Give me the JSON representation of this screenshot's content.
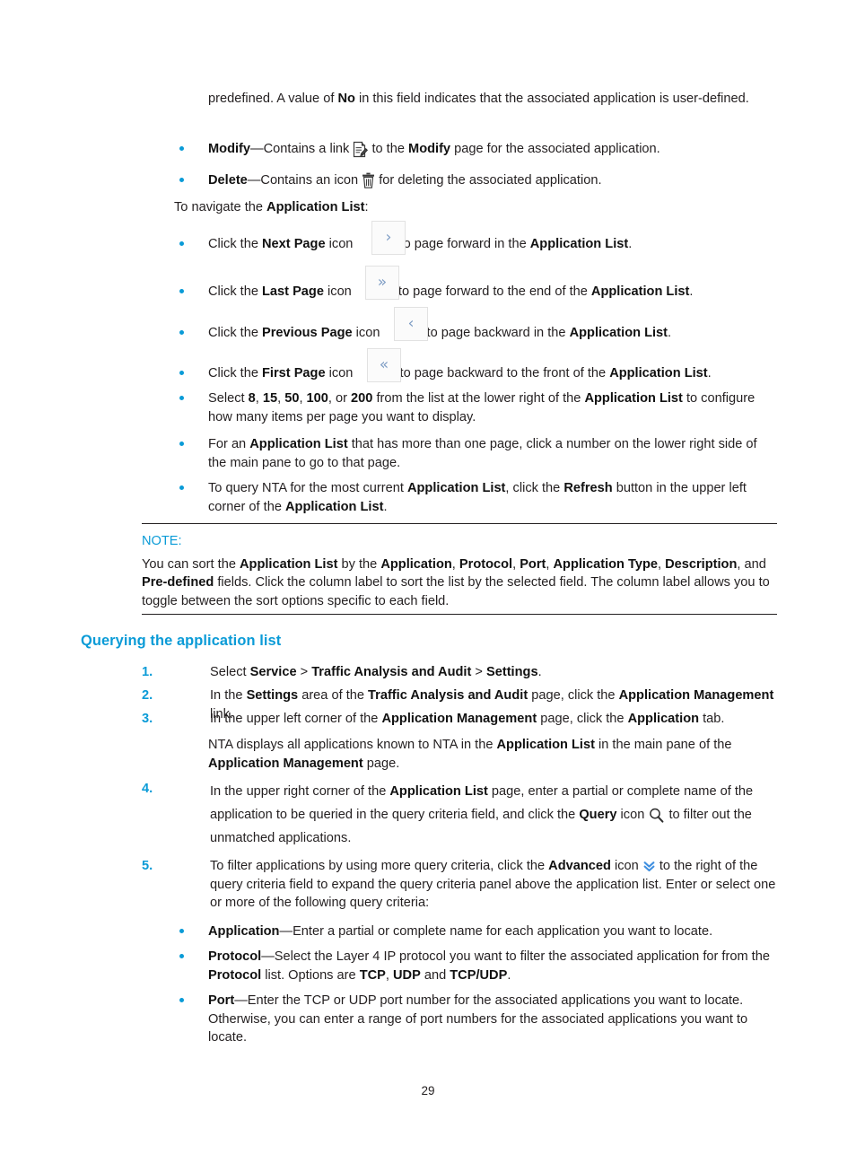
{
  "document": {
    "page_number": "29",
    "accent_color": "#0a9bd7",
    "text_color": "#231f20"
  },
  "intro": {
    "line1_a": "predefined. A value of ",
    "line1_b": "No",
    "line1_c": " in this field indicates that the associated application is user-defined."
  },
  "field_bullets": [
    {
      "term": "Modify",
      "before_icon": "—Contains a link ",
      "icon": "modify-icon",
      "after_icon_a": " to the ",
      "after_icon_b": "Modify",
      "after_icon_c": " page for the associated application."
    },
    {
      "term": "Delete",
      "before_icon": "—Contains an icon ",
      "icon": "trash-icon",
      "after_icon_a": " for deleting the associated application.",
      "after_icon_b": "",
      "after_icon_c": ""
    }
  ],
  "navigate_intro": {
    "a": "To navigate the ",
    "b": "Application List",
    "c": ":"
  },
  "navigation_bullets": [
    {
      "lead": "Click the ",
      "term": "Next Page",
      "mid": " icon ",
      "icon": "chevron-right-icon",
      "glyph": "›",
      "tail_a": " to page forward in the ",
      "tail_b": "Application List",
      "tail_c": "."
    },
    {
      "lead": "Click the ",
      "term": "Last Page",
      "mid": " icon ",
      "icon": "chevron-double-right-icon",
      "glyph": "»",
      "tail_a": " to page forward to the end of the ",
      "tail_b": "Application List",
      "tail_c": "."
    },
    {
      "lead": "Click the ",
      "term": "Previous Page",
      "mid": " icon ",
      "icon": "chevron-left-icon",
      "glyph": "‹",
      "tail_a": " to page backward in the ",
      "tail_b": "Application List",
      "tail_c": "."
    },
    {
      "lead": "Click the ",
      "term": "First Page",
      "mid": " icon ",
      "icon": "chevron-double-left-icon",
      "glyph": "«",
      "tail_a": " to page backward to the front of the ",
      "tail_b": "Application List",
      "tail_c": "."
    }
  ],
  "page_size_bullet": {
    "lead": "Select ",
    "options": [
      "8",
      "15",
      "50",
      "100",
      "200"
    ],
    "mid": " from the list at the lower right of the ",
    "term": "Application List",
    "tail": " to configure how many items per page you want to display."
  },
  "multi_page_bullet": {
    "lead": "For an ",
    "term": "Application List",
    "tail": " that has more than one page, click a number on the lower right side of the main pane to go to that page."
  },
  "refresh_bullet": {
    "lead": "To query NTA for the most current ",
    "term1": "Application List",
    "mid1": ", click the ",
    "term2": "Refresh",
    "mid2": " button in the upper left corner of the ",
    "term3": "Application List",
    "tail": "."
  },
  "note": {
    "label": "NOTE:",
    "body_a": "You can sort the ",
    "body_b": "Application List",
    "body_c": " by the ",
    "fields": [
      "Application",
      "Protocol",
      "Port",
      "Application Type",
      "Description"
    ],
    "body_d": ", and ",
    "body_e": "Pre-defined",
    "body_f": " fields. Click the column label to sort the list by the selected field. The column label allows you to toggle between the sort options specific to each field."
  },
  "section": {
    "heading": "Querying the application list"
  },
  "steps": [
    {
      "number": "1.",
      "lead": "Select ",
      "parts": [
        "Service",
        " > ",
        "Traffic Analysis and Audit",
        " > ",
        "Settings"
      ],
      "tail": "."
    },
    {
      "number": "2.",
      "lead": "In the ",
      "b1": "Settings",
      "m1": " area of the ",
      "b2": "Traffic Analysis and Audit",
      "m2": " page, click the ",
      "b3": "Application Management",
      "tail": " link."
    },
    {
      "number": "3.",
      "lead": "In the upper left corner of the ",
      "b1": "Application Management",
      "m1": " page, click the ",
      "b2": "Application",
      "tail": " tab."
    },
    {
      "number": "4.",
      "lead": "In the upper right corner of the ",
      "b1": "Application List",
      "m1": " page, enter a partial or complete name of the application to be queried in the query criteria field, and click the ",
      "b2": "Query",
      "m2": " icon ",
      "icon": "search-icon",
      "tail": " to filter out the unmatched applications."
    },
    {
      "number": "5.",
      "lead": "To filter applications by using more query criteria, click the ",
      "b1": "Advanced",
      "m1": " icon ",
      "icon": "chevron-double-down-icon",
      "tail": " to the right of the query criteria field to expand the query criteria panel above the application list. Enter or select one or more of the following query criteria:"
    }
  ],
  "step3_note": {
    "a": "NTA displays all applications known to NTA in the ",
    "b": "Application List",
    "c": " in the main pane of the ",
    "d": "Application Management",
    "e": " page."
  },
  "criteria_bullets": [
    {
      "term": "Application",
      "text": "—Enter a partial or complete name for each application you want to locate."
    },
    {
      "term": "Protocol",
      "text_a": "—Select the Layer 4 IP protocol you want to filter the associated application for from the ",
      "term_b": "Protocol",
      "text_b": " list. Options are ",
      "options": [
        "TCP",
        "UDP",
        "TCP/UDP"
      ],
      "joiner": ", ",
      "joiner2": " and ",
      "text_c": "."
    },
    {
      "term": "Port",
      "text": "—Enter the TCP or UDP port number for the associated applications you want to locate. Otherwise, you can enter a range of port numbers for the associated applications you want to locate."
    }
  ]
}
